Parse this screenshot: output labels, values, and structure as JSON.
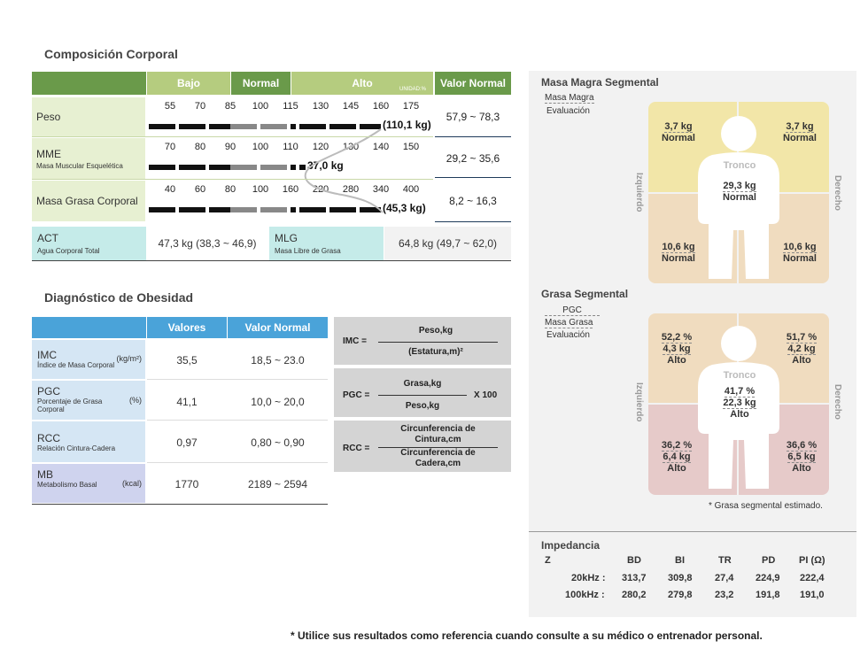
{
  "composition": {
    "title": "Composición Corporal",
    "headers": {
      "bajo": "Bajo",
      "normal": "Normal",
      "alto": "Alto",
      "unidad": "UNIDAD:%",
      "valor_normal": "Valor Normal"
    },
    "rows": [
      {
        "label": "Peso",
        "sub": "",
        "ticks": [
          "55",
          "70",
          "85",
          "100",
          "115",
          "130",
          "145",
          "160",
          "175"
        ],
        "value": "(110,1 kg)",
        "range": "57,9 ~ 78,3"
      },
      {
        "label": "MME",
        "sub": "Masa Muscular Esquelética",
        "ticks": [
          "70",
          "80",
          "90",
          "100",
          "110",
          "120",
          "130",
          "140",
          "150"
        ],
        "value": "37,0 kg",
        "range": "29,2 ~ 35,6"
      },
      {
        "label": "Masa Grasa Corporal",
        "sub": "",
        "ticks": [
          "40",
          "60",
          "80",
          "100",
          "160",
          "220",
          "280",
          "340",
          "400"
        ],
        "value": "(45,3 kg)",
        "range": "8,2 ~ 16,3"
      }
    ],
    "act": {
      "label": "ACT",
      "sub": "Agua Corporal Total",
      "value": "47,3 kg (38,3 ~ 46,9)"
    },
    "mlg": {
      "label": "MLG",
      "sub": "Masa Libre de Grasa",
      "value": "64,8 kg (49,7 ~ 62,0)"
    }
  },
  "obesity": {
    "title": "Diagnóstico de Obesidad",
    "headers": {
      "valores": "Valores",
      "valor_normal": "Valor Normal"
    },
    "rows": [
      {
        "label": "IMC",
        "sub": "Índice de Masa Corporal",
        "unit": "(kg/m²)",
        "value": "35,5",
        "range": "18,5 ~ 23.0"
      },
      {
        "label": "PGC",
        "sub": "Porcentaje de Grasa Corporal",
        "unit": "(%)",
        "value": "41,1",
        "range": "10,0 ~ 20,0"
      },
      {
        "label": "RCC",
        "sub": "Relación Cintura-Cadera",
        "unit": "",
        "value": "0,97",
        "range": "0,80 ~ 0,90"
      },
      {
        "label": "MB",
        "sub": "Metabolismo Basal",
        "unit": "(kcal)",
        "value": "1770",
        "range": "2189 ~ 2594"
      }
    ]
  },
  "formulas": [
    {
      "name": "IMC =",
      "num": "Peso,kg",
      "den": "(Estatura,m)²",
      "mult": ""
    },
    {
      "name": "PGC =",
      "num": "Grasa,kg",
      "den": "Peso,kg",
      "mult": "X 100"
    },
    {
      "name": "RCC =",
      "num": "Circunferencia de Cintura,cm",
      "den": "Circunferencia de Cadera,cm",
      "mult": ""
    }
  ],
  "lean": {
    "title": "Masa Magra Segmental",
    "legend1": "Masa Magra",
    "legend2": "Evaluación",
    "left_label": "Izquierdo",
    "right_label": "Derecho",
    "trunk_label": "Tronco",
    "ul": {
      "v1": "3,7 kg",
      "ev": "Normal"
    },
    "ur": {
      "v1": "3,7 kg",
      "ev": "Normal"
    },
    "trunk": {
      "v1": "29,3 kg",
      "ev": "Normal"
    },
    "ll": {
      "v1": "10,6 kg",
      "ev": "Normal"
    },
    "lr": {
      "v1": "10,6 kg",
      "ev": "Normal"
    }
  },
  "fat": {
    "title": "Grasa Segmental",
    "legend1": "PGC",
    "legend2": "Masa Grasa",
    "legend3": "Evaluación",
    "left_label": "Izquierdo",
    "right_label": "Derecho",
    "trunk_label": "Tronco",
    "ul": {
      "p": "52,2 %",
      "kg": "4,3 kg",
      "ev": "Alto"
    },
    "ur": {
      "p": "51,7 %",
      "kg": "4,2 kg",
      "ev": "Alto"
    },
    "trunk": {
      "p": "41,7 %",
      "kg": "22,3 kg",
      "ev": "Alto"
    },
    "ll": {
      "p": "36,2 %",
      "kg": "6,4 kg",
      "ev": "Alto"
    },
    "lr": {
      "p": "36,6 %",
      "kg": "6,5 kg",
      "ev": "Alto"
    },
    "note": "* Grasa segmental estimado."
  },
  "impedance": {
    "title": "Impedancia",
    "z": "Z",
    "cols": [
      "BD",
      "BI",
      "TR",
      "PD",
      "PI (Ω)"
    ],
    "rows": [
      {
        "freq": "20kHz :",
        "vals": [
          "313,7",
          "309,8",
          "27,4",
          "224,9",
          "222,4"
        ]
      },
      {
        "freq": "100kHz :",
        "vals": [
          "280,2",
          "279,8",
          "23,2",
          "191,8",
          "191,0"
        ]
      }
    ]
  },
  "footer": "* Utilice sus resultados como referencia cuando consulte a su médico o entrenador personal.",
  "colors": {
    "green_dark": "#6a9a4a",
    "green_light": "#b5cc7f",
    "blue": "#4aa3d9",
    "teal": "#c5ebe9"
  }
}
